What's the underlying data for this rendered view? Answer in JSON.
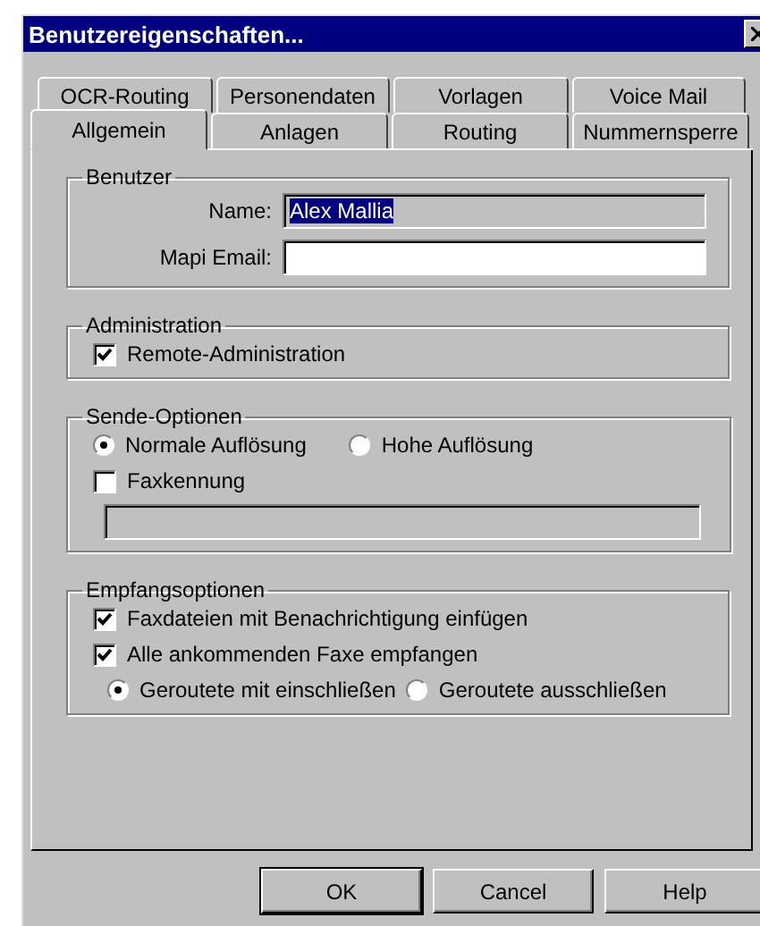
{
  "window": {
    "title": "Benutzereigenschaften..."
  },
  "tab_rows": [
    [
      {
        "label": "OCR-Routing",
        "selected": false
      },
      {
        "label": "Personendaten",
        "selected": false
      },
      {
        "label": "Vorlagen",
        "selected": false
      },
      {
        "label": "Voice Mail",
        "selected": false
      }
    ],
    [
      {
        "label": "Allgemein",
        "selected": true
      },
      {
        "label": "Anlagen",
        "selected": false
      },
      {
        "label": "Routing",
        "selected": false
      },
      {
        "label": "Nummernsperre",
        "selected": false
      }
    ]
  ],
  "groups": [
    {
      "title": "Benutzer",
      "items": [
        {
          "kind": "field",
          "label": "Name:",
          "value": "Alex Mallia",
          "disabled": true,
          "highlighted": true
        },
        {
          "kind": "field",
          "label": "Mapi Email:",
          "disabled": false
        }
      ]
    },
    {
      "title": "Administration",
      "items": [
        {
          "kind": "checkbox",
          "label": "Remote-Administration",
          "checked": true
        }
      ]
    },
    {
      "title": "Sende-Optionen",
      "items": [
        {
          "kind": "radios",
          "indented": false,
          "options": [
            {
              "label": "Normale Auflösung",
              "selected": true
            },
            {
              "label": "Hohe Auflösung",
              "selected": false
            }
          ]
        },
        {
          "kind": "checkbox",
          "label": "Faxkennung",
          "checked": false
        },
        {
          "kind": "field",
          "disabled": true
        }
      ]
    },
    {
      "title": "Empfangsoptionen",
      "items": [
        {
          "kind": "checkbox",
          "label": "Faxdateien mit Benachrichtigung einfügen",
          "checked": true
        },
        {
          "kind": "checkbox",
          "label": "Alle ankommenden Faxe empfangen",
          "checked": true
        },
        {
          "kind": "radios",
          "indented": true,
          "options": [
            {
              "label": "Geroutete mit einschließen",
              "selected": true
            },
            {
              "label": "Geroutete ausschließen",
              "selected": false
            }
          ]
        }
      ]
    }
  ],
  "buttons": [
    {
      "label": "OK",
      "default": true
    },
    {
      "label": "Cancel",
      "default": false
    },
    {
      "label": "Help",
      "default": false
    }
  ]
}
